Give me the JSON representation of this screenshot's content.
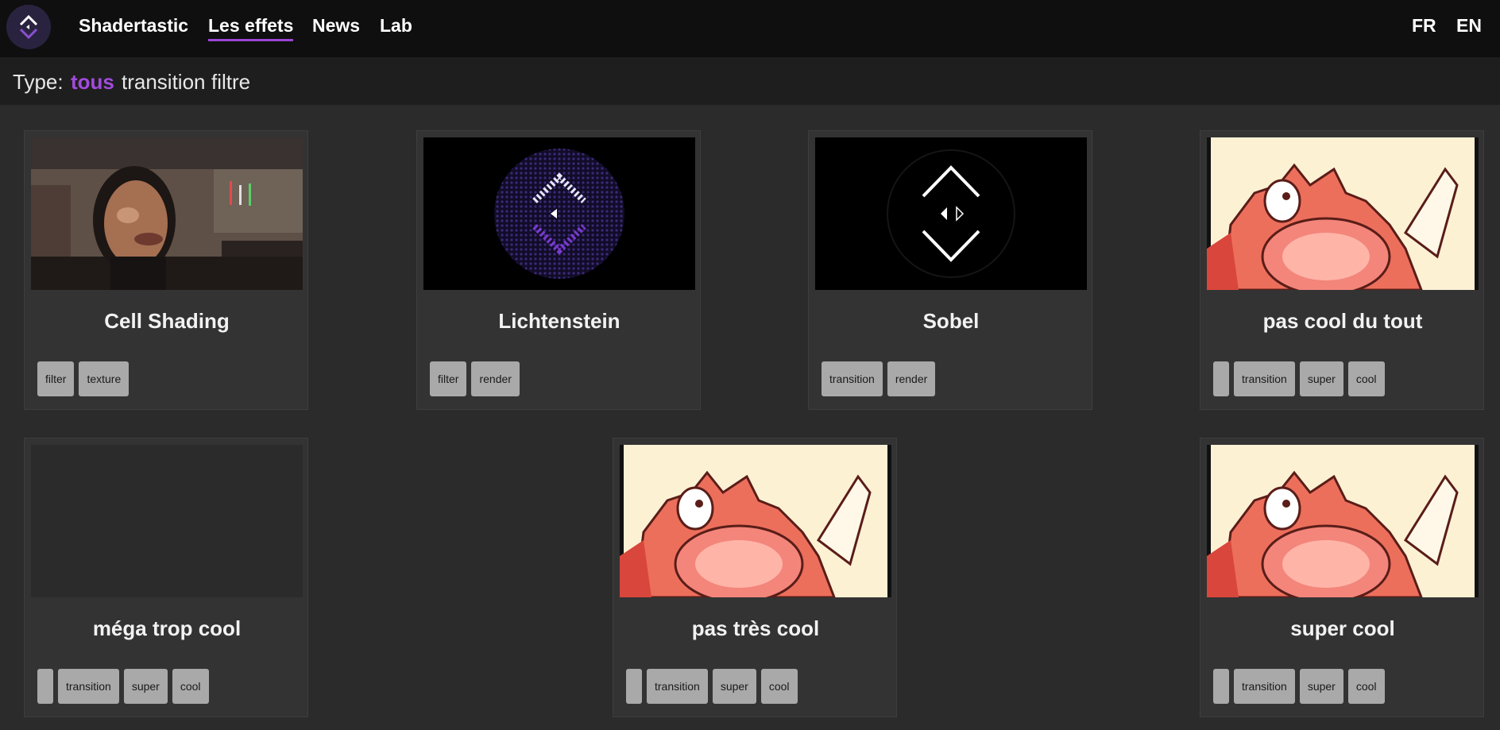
{
  "nav": {
    "items": [
      {
        "label": "Shadertastic",
        "active": false
      },
      {
        "label": "Les effets",
        "active": true
      },
      {
        "label": "News",
        "active": false
      },
      {
        "label": "Lab",
        "active": false
      }
    ],
    "languages": [
      "FR",
      "EN"
    ],
    "accent": "#9b45d6"
  },
  "filter": {
    "label": "Type:",
    "options": [
      {
        "label": "tous",
        "active": true
      },
      {
        "label": "transition",
        "active": false
      },
      {
        "label": "filtre",
        "active": false
      }
    ]
  },
  "cards": [
    {
      "title": "Cell Shading",
      "thumbnail": "cell-shading-portrait",
      "tags": [
        "filter",
        "texture"
      ]
    },
    {
      "title": "Lichtenstein",
      "thumbnail": "lichtenstein-logo",
      "tags": [
        "filter",
        "render"
      ]
    },
    {
      "title": "Sobel",
      "thumbnail": "sobel-logo",
      "tags": [
        "transition",
        "render"
      ]
    },
    {
      "title": "pas cool du tout",
      "thumbnail": "cartoon-screaming-creature",
      "tags": [
        "",
        "transition",
        "super",
        "cool"
      ]
    },
    {
      "title": "méga trop cool",
      "thumbnail": "empty",
      "tags": [
        "",
        "transition",
        "super",
        "cool"
      ]
    },
    {
      "title": "pas très cool",
      "thumbnail": "cartoon-screaming-creature",
      "tags": [
        "",
        "transition",
        "super",
        "cool"
      ]
    },
    {
      "title": "super cool",
      "thumbnail": "cartoon-screaming-creature",
      "tags": [
        "",
        "transition",
        "super",
        "cool"
      ]
    }
  ]
}
